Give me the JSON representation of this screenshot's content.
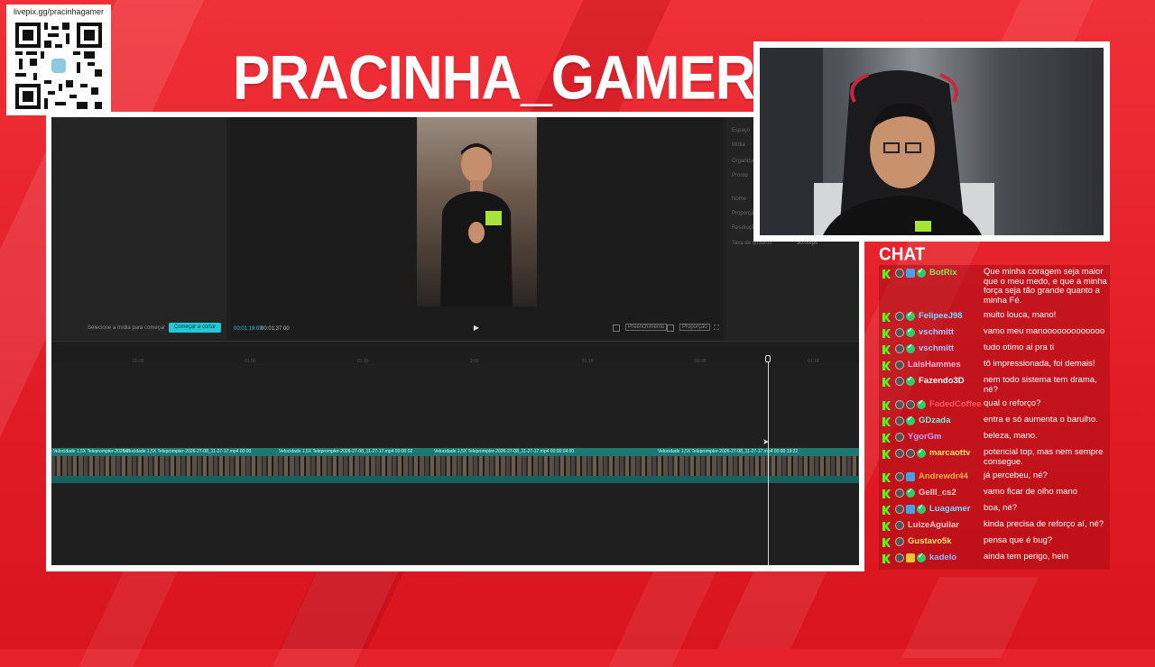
{
  "qr": {
    "url": "livepix.gg/pracinhagamer"
  },
  "title": "PRACINHA_GAMER",
  "editor": {
    "left_hint": "Selecione a mídia para começar",
    "start_button": "Começar a cortar",
    "time_current": "00:01:19:09",
    "time_total": "00:01:37:00",
    "fill_label": "Preenchimento",
    "ratio_label": "Proporção",
    "props": [
      "Espaço",
      "Mídia",
      "Organizar",
      "Pronto",
      "Nome",
      "Proporção",
      "Resolução",
      "Taxa de quadros"
    ],
    "frame_rate": "30.00fps",
    "ruler_ticks": [
      "00:00",
      "01:00",
      "01:15",
      "2:00",
      "01:16",
      "00:00",
      "01:10"
    ],
    "clips": [
      "Velocidade 1,5X  Teleprompter-2026-2",
      "Velocidade 1,5X  Teleprompter-2026-27-08_11-27-17.mp4  00:00",
      "Velocidade 1,5X  Teleprompter-2026-27-08_11-27-17.mp4  00:00:02",
      "Velocidade 1,5X  Teleprompter-2026-27-08_11-27-17.mp4  00:00:04:00",
      "Velocidade 1,5X  Teleprompter-2026-27-08_11-27-17.mp4  00:00:19:22"
    ]
  },
  "chat": {
    "title": "CHAT",
    "messages": [
      {
        "user": "BotRix",
        "color": "#7ee85a",
        "text": "Que minha coragem seja maior que o meu medo, e que a minha força seja tão grande quanto a minha Fé.",
        "badges": [
          "avatar",
          "square-blue",
          "verified"
        ]
      },
      {
        "user": "FelipeeJ98",
        "color": "#7ad7ff",
        "text": "muito louca, mano!",
        "badges": [
          "avatar",
          "verified"
        ]
      },
      {
        "user": "vschmitt",
        "color": "#a7c7ff",
        "text": "vamo meu manooooooooooooo",
        "badges": [
          "avatar",
          "verified"
        ]
      },
      {
        "user": "vschmitt",
        "color": "#a7c7ff",
        "text": "tudo otimo ai pra ti",
        "badges": [
          "avatar",
          "verified"
        ]
      },
      {
        "user": "LaisHammes",
        "color": "#ffb3d9",
        "text": "tô impressionada, foi demais!",
        "badges": [
          "avatar"
        ]
      },
      {
        "user": "Fazendo3D",
        "color": "#ffffff",
        "text": "nem todo sistema tem drama, né?",
        "badges": [
          "avatar",
          "verified"
        ]
      },
      {
        "user": "FadedCoffee",
        "color": "#ff5a6a",
        "text": "qual o reforço?",
        "badges": [
          "avatar",
          "avatar",
          "verified"
        ]
      },
      {
        "user": "GDzada",
        "color": "#6ff0d8",
        "text": "entra e só aumenta o barulho.",
        "badges": [
          "avatar",
          "verified"
        ]
      },
      {
        "user": "YgorGm",
        "color": "#c9a0ff",
        "text": "beleza, mano.",
        "badges": [
          "avatar"
        ]
      },
      {
        "user": "marcaottv",
        "color": "#ffe36b",
        "text": "potencial top, mas nem sempre consegue.",
        "badges": [
          "avatar",
          "avatar",
          "verified"
        ]
      },
      {
        "user": "Andrewdr44",
        "color": "#ffb347",
        "text": "já percebeu, né?",
        "badges": [
          "avatar",
          "square-blue"
        ]
      },
      {
        "user": "GeIII_cs2",
        "color": "#ffc8c8",
        "text": "vamo ficar de olho mano",
        "badges": [
          "avatar",
          "verified"
        ]
      },
      {
        "user": "Luagamer",
        "color": "#7ad7ff",
        "text": "boa, né?",
        "badges": [
          "avatar",
          "square-blue",
          "verified"
        ]
      },
      {
        "user": "LuizeAguilar",
        "color": "#ffc8c8",
        "text": "kinda precisa de reforço aí, né?",
        "badges": [
          "avatar"
        ]
      },
      {
        "user": "Gustavo5k",
        "color": "#ffe36b",
        "text": "pensa que é bug?",
        "badges": [
          "avatar"
        ]
      },
      {
        "user": "kadelo",
        "color": "#8fb8ff",
        "text": "ainda tem perigo, hein",
        "badges": [
          "avatar",
          "square-yellow",
          "verified"
        ]
      }
    ]
  }
}
